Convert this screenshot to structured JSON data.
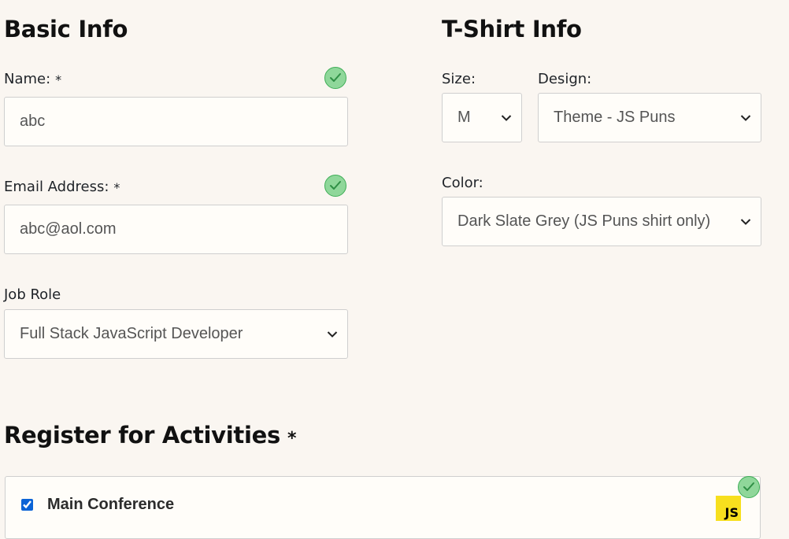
{
  "basic_info": {
    "heading": "Basic Info",
    "name": {
      "label": "Name:",
      "required_mark": "*",
      "value": "abc",
      "valid": true
    },
    "email": {
      "label": "Email Address:",
      "required_mark": "*",
      "value": "abc@aol.com",
      "valid": true
    },
    "job_role": {
      "label": "Job Role",
      "selected": "Full Stack JavaScript Developer"
    }
  },
  "tshirt_info": {
    "heading": "T-Shirt Info",
    "size": {
      "label": "Size:",
      "selected": "M"
    },
    "design": {
      "label": "Design:",
      "selected": "Theme - JS Puns"
    },
    "color": {
      "label": "Color:",
      "selected": "Dark Slate Grey (JS Puns shirt only)"
    }
  },
  "activities": {
    "heading": "Register for Activities",
    "required_mark": "*",
    "valid": true,
    "items": [
      {
        "label": "Main Conference",
        "checked": true,
        "icon": "js-logo-icon",
        "icon_text": "JS"
      }
    ]
  },
  "colors": {
    "background": "#faf6f1",
    "valid_green": "#8fd79a",
    "js_yellow": "#f7df1e"
  }
}
